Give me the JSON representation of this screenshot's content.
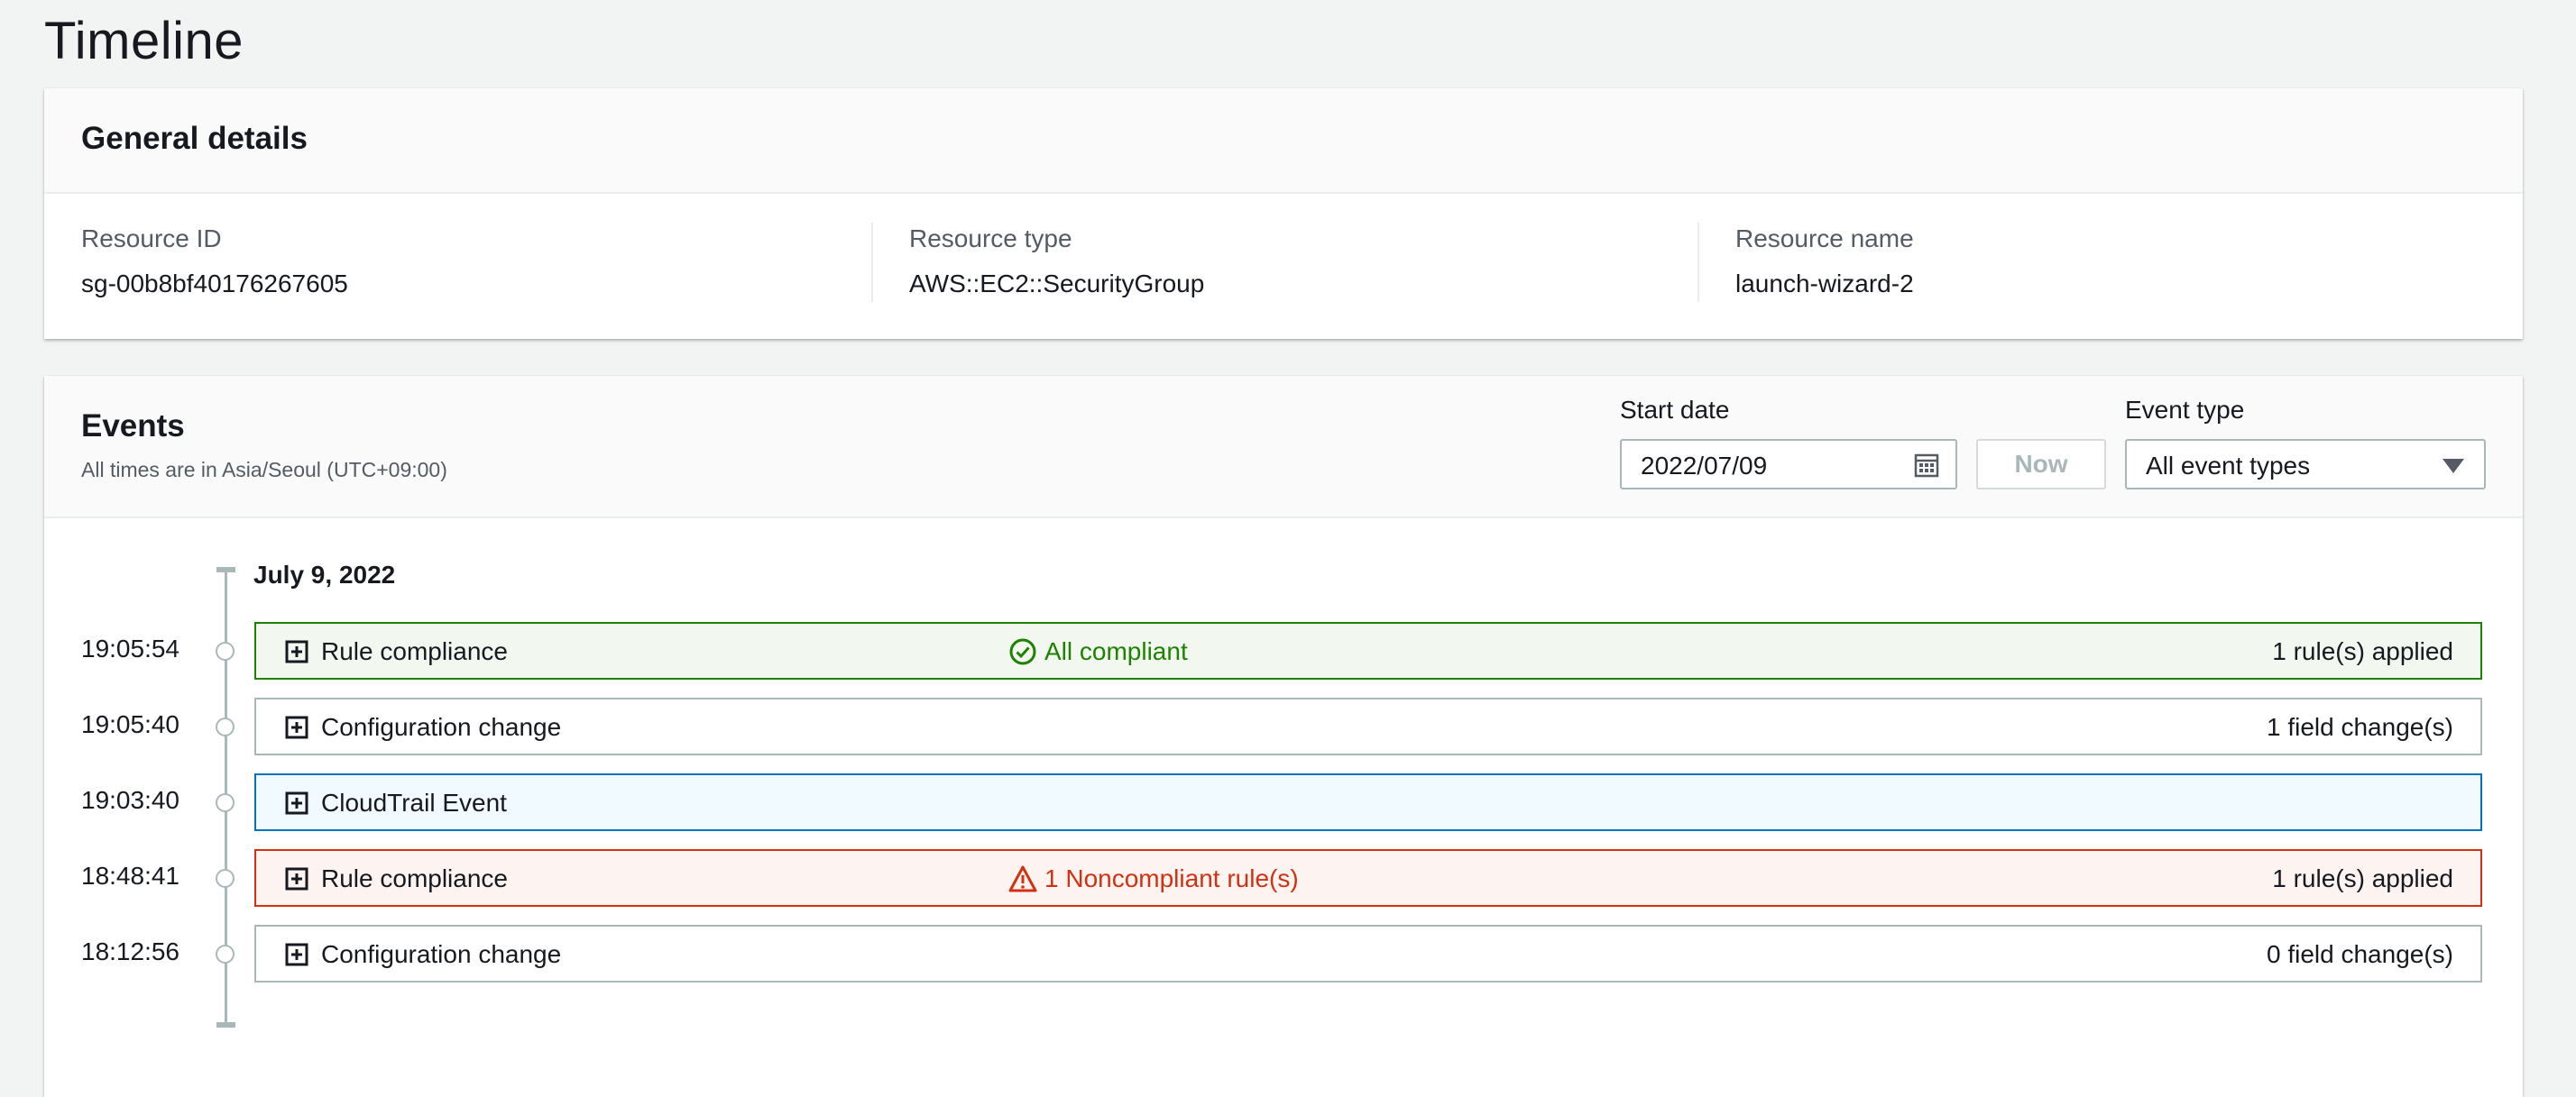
{
  "page": {
    "title": "Timeline"
  },
  "general_details": {
    "title": "General details",
    "fields": [
      {
        "label": "Resource ID",
        "value": "sg-00b8bf40176267605"
      },
      {
        "label": "Resource type",
        "value": "AWS::EC2::SecurityGroup"
      },
      {
        "label": "Resource name",
        "value": "launch-wizard-2"
      }
    ]
  },
  "events": {
    "title": "Events",
    "subtitle": "All times are in Asia/Seoul (UTC+09:00)",
    "start_date": {
      "label": "Start date",
      "value": "2022/07/09",
      "icon": "calendar-icon"
    },
    "now_button": {
      "label": "Now",
      "disabled": true
    },
    "event_type": {
      "label": "Event type",
      "selected": "All event types"
    },
    "timeline_date": "July 9, 2022",
    "items": [
      {
        "time": "19:05:54",
        "label": "Rule compliance",
        "status": "All compliant",
        "status_kind": "ok",
        "right": "1 rule(s) applied",
        "variant": "green"
      },
      {
        "time": "19:05:40",
        "label": "Configuration change",
        "status": "",
        "status_kind": "",
        "right": "1 field change(s)",
        "variant": "plain"
      },
      {
        "time": "19:03:40",
        "label": "CloudTrail Event",
        "status": "",
        "status_kind": "",
        "right": "",
        "variant": "blue"
      },
      {
        "time": "18:48:41",
        "label": "Rule compliance",
        "status": "1 Noncompliant rule(s)",
        "status_kind": "bad",
        "right": "1 rule(s) applied",
        "variant": "red"
      },
      {
        "time": "18:12:56",
        "label": "Configuration change",
        "status": "",
        "status_kind": "",
        "right": "0 field change(s)",
        "variant": "plain"
      }
    ]
  },
  "colors": {
    "success": "#1d8102",
    "error": "#d13212",
    "info": "#0073bb",
    "border": "#aab7b8"
  }
}
